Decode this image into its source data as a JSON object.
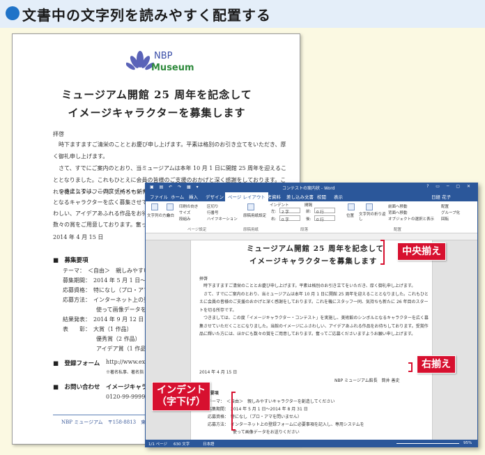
{
  "heading": "文書中の文字列を読みやすく配置する",
  "doc": {
    "logo_line1": "NBP",
    "logo_line2": "Museum",
    "title_line1": "ミュージアム開館 25 周年を記念して",
    "title_line2": "イメージキャラクターを募集します",
    "salutation": "拝啓",
    "para1": "　時下ますますご清栄のこととお慶び申し上げます。平素は格別のお引き立てをいただき、厚く御礼申し上げます。",
    "para2": "　さて、すでにご案内のとおり、当ミュージアムは本年 10 月 1 日に開館 25 周年を迎えることとなりました。これもひとえに会員の皆様のご支援のおかげと深く感謝をしております。これを機にスタッフ一同、気持ちも新たに 26 年目のスタートを切る所存です。",
    "para3_lines": [
      "　つきましては、この度「イメージキャ",
      "となるキャラクターを広く募集させて",
      "わしい、アイデアあふれる作品をお待ち",
      "数々の賞をご用意しております。奮って"
    ],
    "date": "2014 年 4 月 15 日",
    "section1": "■　募集要項",
    "reqs": [
      "テーマ：　＜自由＞　親しみやすい",
      "募集期間：　2014 年 5 月 1 日～201",
      "応募資格：　特になし（プロ・アマ",
      "応募方法：　インターネット上の登",
      "　　　　　　使って画像データをお",
      "結果発表：　2014 年 9 月 12 日（金",
      "表　　彰：　大賞（1 作品）",
      "　　　　　　優秀賞（2 作品）",
      "　　　　　　アイデア賞（1 作品）"
    ],
    "section2": "■　登録フォーム",
    "form_url": "http://www.exam",
    "form_note": "※著名私事、著名指",
    "section3": "■　お問い合わせ",
    "contact": "イメージキャラ",
    "phone": "0120-99-9999",
    "footer": "NBP ミュージアム　〒158-8813　東京都"
  },
  "word": {
    "title": "コンテストの案内状 - Word",
    "user": "日経 花子",
    "tabs": [
      "ファイル",
      "ホーム",
      "挿入",
      "デザイン",
      "ページ レイアウト",
      "参考資料",
      "差し込み文書",
      "校閲",
      "表示"
    ],
    "active_tab": "ページ レイアウト",
    "ribbon": {
      "text_dir": "文字列の方向",
      "margins": "余白",
      "orientation": "印刷の向き",
      "size": "サイズ",
      "columns": "段組み",
      "breaks": "区切り",
      "line_numbers": "行番号",
      "hyphenation": "ハイフネーション",
      "draft": "原稿用紙設定",
      "indent": "インデント",
      "spacing": "間隔",
      "left_label": "左:",
      "left_val": "2 字",
      "right_label": "右:",
      "right_val": "0 字",
      "before_label": "前:",
      "before_val": "0 行",
      "after_label": "後:",
      "after_val": "0 行",
      "position": "位置",
      "wrap": "文字列の折り返し",
      "forward": "前面へ移動",
      "backward": "背面へ移動",
      "selection": "オブジェクトの選択と表示",
      "align": "配置",
      "group": "グループ化",
      "rotate": "回転",
      "grp_page": "ページ設定",
      "grp_draft": "原稿用紙",
      "grp_para": "段落",
      "grp_arrange": "配置"
    },
    "page": {
      "title_line1": "ミュージアム開館 25 周年を記念して",
      "title_line2": "イメージキャラクターを募集します",
      "salutation": "拝啓",
      "body": "　時下ますますご清栄のこととお慶び申し上げます。平素は格別のお引き立てをいただき、厚く御礼申し上げます。\n　さて、すでにご案内のとおり、当ミュージアムは本年 10 月 1 日に開館 25 周年を迎えることとなりました。これもひとえに会員の皆様のご支援のおかげと深く感謝をしております。これを機にスタッフ一同、気持ちも新たに 26 年目のスタートを切る所存です。\n　つきましては、この度「イメージキャラクター・コンテスト」を実施し、美術館のシンボルとなるキャラクターを広く募集させていただくことになりました。当館のイメージにふさわしい、アイデアあふれる作品をお待ちしております。受賞作品に輝いた方には、ほかにも数々の賞をご用意しております。奮ってご応募くださいますようお願い申し上げます。",
      "closing": "敬具",
      "date": "2014 年 4 月 15 日",
      "sender": "NBP ミュージアム館長　筒井 善史",
      "section": "■　募集要項",
      "reqs": [
        "テーマ：　＜自由＞　親しみやすいキャラクターを創造してください",
        "募集期間：　2014 年 5 月 1 日～2014 年 8 月 31 日",
        "応募資格：　特になし（プロ・アマを問いません）",
        "応募方法：　インターネット上の登録フォームに必要事項を記入し、専用システムを",
        "　　　　　　使って画像データをお送りください"
      ]
    },
    "status": {
      "page": "1/1 ページ",
      "words": "630 文字",
      "lang": "日本語",
      "zoom": "95%"
    }
  },
  "callouts": {
    "center": "中央揃え",
    "right": "右揃え",
    "indent_line1": "インデント",
    "indent_line2": "（字下げ）"
  },
  "colors": {
    "accent": "#d7102f",
    "word_blue": "#2b579a",
    "heading_dot": "#1f73c8"
  }
}
